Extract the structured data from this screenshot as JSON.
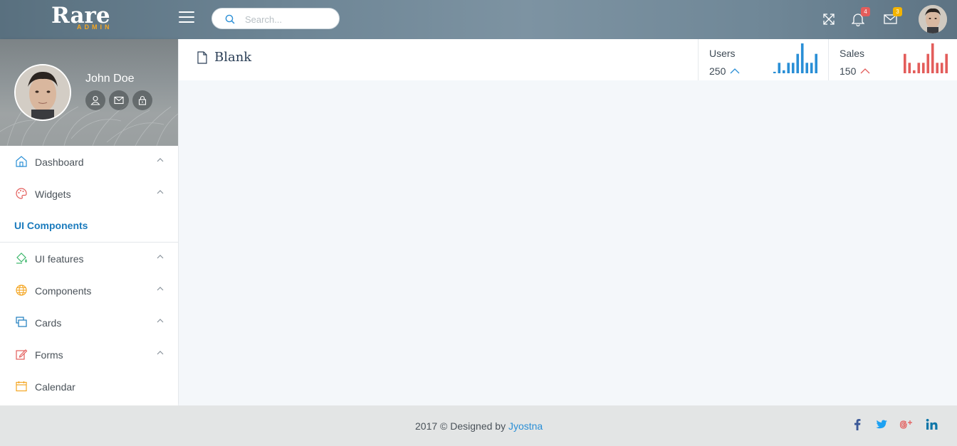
{
  "header": {
    "logo_main": "Rare",
    "logo_sub": "ADMIN",
    "search_placeholder": "Search...",
    "notifications_count": "4",
    "messages_count": "3",
    "icons": [
      "menu-icon",
      "search-icon",
      "fullscreen-icon",
      "bell-icon",
      "envelope-icon",
      "avatar"
    ]
  },
  "profile": {
    "name": "John Doe",
    "actions": [
      "user-icon",
      "envelope-icon",
      "lock-icon"
    ]
  },
  "sidebar": {
    "items": [
      {
        "label": "Dashboard",
        "icon": "home-icon",
        "color": "#2a8fd6"
      },
      {
        "label": "Widgets",
        "icon": "palette-icon",
        "color": "#e35d5b"
      }
    ],
    "section_title": "UI Components",
    "section_items": [
      {
        "label": "UI features",
        "icon": "paint-bucket-icon",
        "color": "#3bb66b"
      },
      {
        "label": "Components",
        "icon": "globe-icon",
        "color": "#f4a623"
      },
      {
        "label": "Cards",
        "icon": "cards-icon",
        "color": "#1b7bbd"
      },
      {
        "label": "Forms",
        "icon": "edit-icon",
        "color": "#e35d5b"
      },
      {
        "label": "Calendar",
        "icon": "calendar-icon",
        "color": "#f4a623"
      }
    ]
  },
  "page": {
    "title": "Blank"
  },
  "stats": [
    {
      "label": "Users",
      "value": "250",
      "trend": "up",
      "color": "#2a8fd6",
      "bars": [
        0.05,
        0.35,
        0.1,
        0.35,
        0.35,
        0.65,
        1.0,
        0.35,
        0.35,
        0.65
      ]
    },
    {
      "label": "Sales",
      "value": "150",
      "trend": "up",
      "color": "#e35d5b",
      "bars": [
        0.65,
        0.35,
        0.1,
        0.35,
        0.35,
        0.65,
        1.0,
        0.35,
        0.35,
        0.65
      ]
    }
  ],
  "footer": {
    "prefix": "2017 © Designed by",
    "author": "Jyostna",
    "social": [
      {
        "name": "facebook-icon",
        "color": "#3b5998"
      },
      {
        "name": "twitter-icon",
        "color": "#1da1f2"
      },
      {
        "name": "google-plus-icon",
        "color": "#e35d5b"
      },
      {
        "name": "linkedin-icon",
        "color": "#0e76a8"
      }
    ]
  }
}
